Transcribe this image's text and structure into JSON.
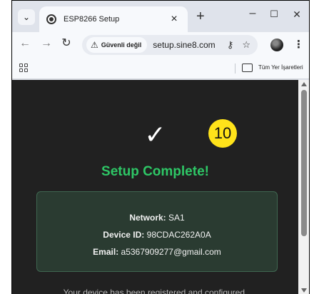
{
  "tab": {
    "title": "ESP8266 Setup",
    "close": "×"
  },
  "tab_strip": {
    "menu": "⌄",
    "new_tab": "+"
  },
  "window_controls": {
    "minimize": "–",
    "maximize": "☐",
    "close": "✕"
  },
  "toolbar": {
    "back": "←",
    "forward": "→",
    "reload": "↻",
    "security_badge": "Güvenli değil",
    "url": "setup.sine8.com",
    "menu": "⋮"
  },
  "bookmarks": {
    "all_bookmarks": "Tüm Yer İşaretleri"
  },
  "content": {
    "check": "✓",
    "step_number": "10",
    "heading": "Setup Complete!",
    "details": [
      {
        "label": "Network:",
        "value": "SA1"
      },
      {
        "label": "Device ID:",
        "value": "98CDAC262A0A"
      },
      {
        "label": "Email:",
        "value": "a5367909277@gmail.com"
      }
    ],
    "footer": "Your device has been registered and configured."
  },
  "colors": {
    "success_green": "#2ec766",
    "step_badge": "#ffe31a",
    "page_background": "#212121",
    "card_background": "#2a3b31"
  },
  "icons": [
    "tab-search-icon",
    "favicon-icon",
    "warning-icon",
    "password-key-icon",
    "star-icon",
    "profile-avatar",
    "apps-grid-icon",
    "folder-icon"
  ]
}
